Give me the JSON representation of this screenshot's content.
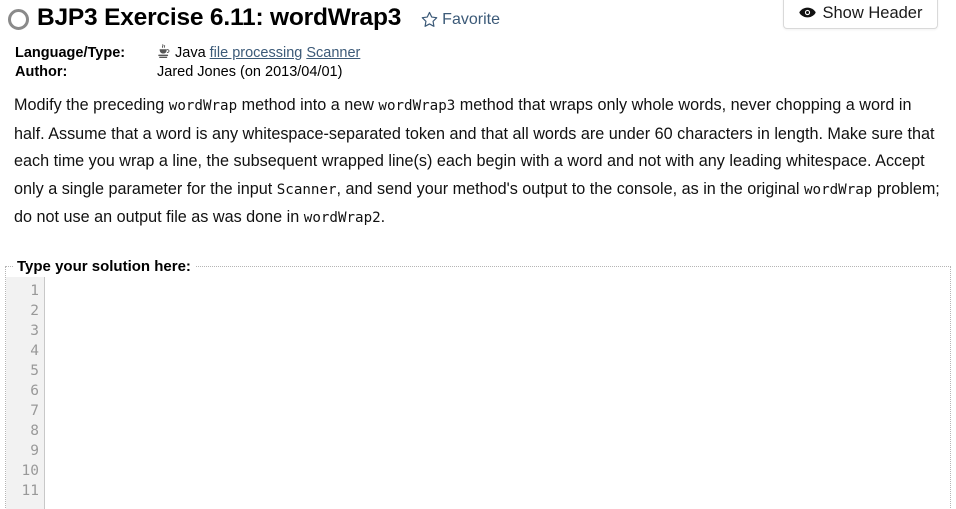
{
  "header_button": {
    "label": "Show Header",
    "icon": "eye-icon"
  },
  "title": {
    "status_icon": "unsolved-circle-icon",
    "text": "BJP3 Exercise 6.11: wordWrap3",
    "favorite_icon": "star-outline-icon",
    "favorite_label": "Favorite"
  },
  "meta": {
    "language_label": "Language/Type:",
    "language_icon": "java-coffee-cup-icon",
    "language_value": "Java",
    "topic_links": [
      "file processing",
      "Scanner"
    ],
    "author_label": "Author:",
    "author_value": "Jared Jones (on 2013/04/01)"
  },
  "problem": {
    "segments": [
      {
        "type": "text",
        "value": "Modify the preceding "
      },
      {
        "type": "code",
        "value": "wordWrap"
      },
      {
        "type": "text",
        "value": " method into a new "
      },
      {
        "type": "code",
        "value": "wordWrap3"
      },
      {
        "type": "text",
        "value": " method that wraps only whole words, never chopping a word in half. Assume that a word is any whitespace-separated token and that all words are under 60 characters in length. Make sure that each time you wrap a line, the subsequent wrapped line(s) each begin with a word and not with any leading whitespace. Accept only a single parameter for the input "
      },
      {
        "type": "code",
        "value": "Scanner"
      },
      {
        "type": "text",
        "value": ", and send your method's output to the console, as in the original "
      },
      {
        "type": "code",
        "value": "wordWrap"
      },
      {
        "type": "text",
        "value": " problem; do not use an output file as was done in "
      },
      {
        "type": "code",
        "value": "wordWrap2"
      },
      {
        "type": "text",
        "value": "."
      }
    ]
  },
  "solution": {
    "legend": "Type your solution here:",
    "line_numbers": [
      "1",
      "2",
      "3",
      "4",
      "5",
      "6",
      "7",
      "8",
      "9",
      "10",
      "11"
    ],
    "code_value": "",
    "code_placeholder": ""
  },
  "colors": {
    "link": "#3c5a78",
    "gutter_bg": "#f2f2f2",
    "gutter_text": "#999999",
    "fieldset_border": "#b5b5b5"
  }
}
